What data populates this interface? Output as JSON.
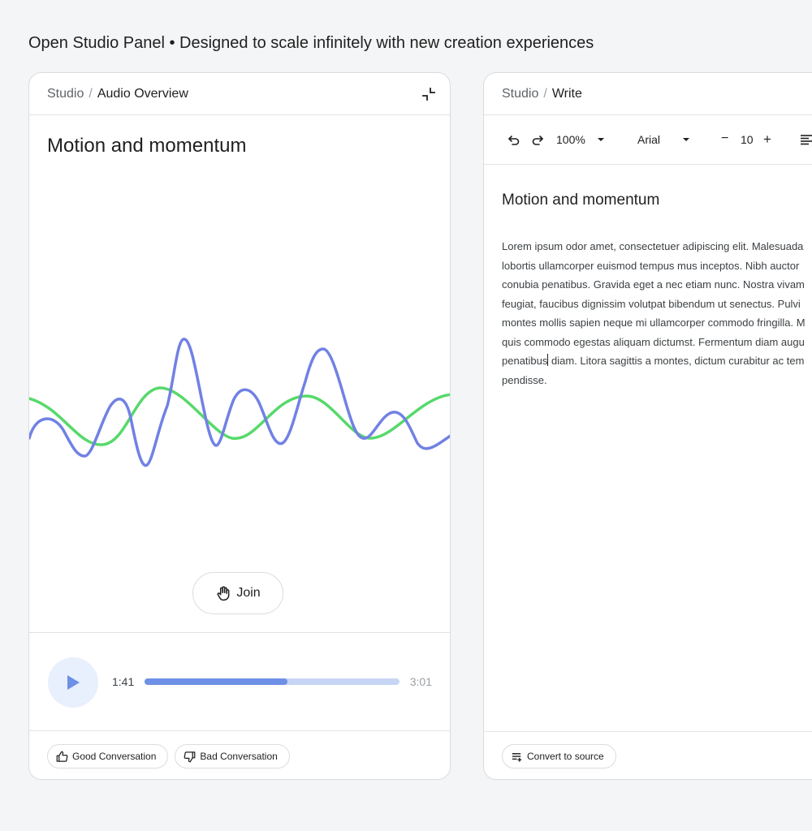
{
  "page": {
    "title": "Open Studio Panel • Designed to scale infinitely with new creation experiences"
  },
  "audio_panel": {
    "breadcrumb": {
      "root": "Studio",
      "separator": "/",
      "current": "Audio Overview"
    },
    "collapse_icon": "collapse-icon",
    "title": "Motion and momentum",
    "join_label": "Join",
    "join_icon": "raised-hand-icon",
    "player": {
      "current_time": "1:41",
      "total_time": "3:01",
      "progress": 0.56,
      "play_icon": "play-icon"
    },
    "feedback": {
      "good_label": "Good Conversation",
      "good_icon": "thumbs-up-icon",
      "bad_label": "Bad Conversation",
      "bad_icon": "thumbs-down-icon"
    },
    "colors": {
      "wave_primary": "#7181e4",
      "wave_secondary": "#57d96b",
      "accent": "#6e90e6"
    }
  },
  "write_panel": {
    "breadcrumb": {
      "root": "Studio",
      "separator": "/",
      "current": "Write"
    },
    "toolbar": {
      "undo_icon": "undo-icon",
      "redo_icon": "redo-icon",
      "zoom": "100%",
      "font": "Arial",
      "font_size": "10",
      "minus": "−",
      "plus": "+",
      "align_icon": "align-left-icon"
    },
    "doc": {
      "title": "Motion and momentum",
      "lines": [
        "Lorem ipsum odor amet, consectetuer adipiscing elit. Malesuada",
        "lobortis ullamcorper euismod tempus mus inceptos. Nibh auctor",
        "conubia penatibus. Gravida eget a nec etiam nunc. Nostra vivam",
        "feugiat, faucibus dignissim volutpat bibendum ut senectus. Pulvi",
        "montes mollis sapien neque mi ullamcorper commodo fringilla. M",
        "quis commodo egestas aliquam dictumst. Fermentum diam augu"
      ],
      "line7_before_caret": "penatibus",
      "line7_after_caret": " diam. Litora sagittis a montes, dictum curabitur ac tem",
      "line8": "pendisse."
    },
    "convert_label": "Convert to source",
    "convert_icon": "convert-list-icon"
  }
}
